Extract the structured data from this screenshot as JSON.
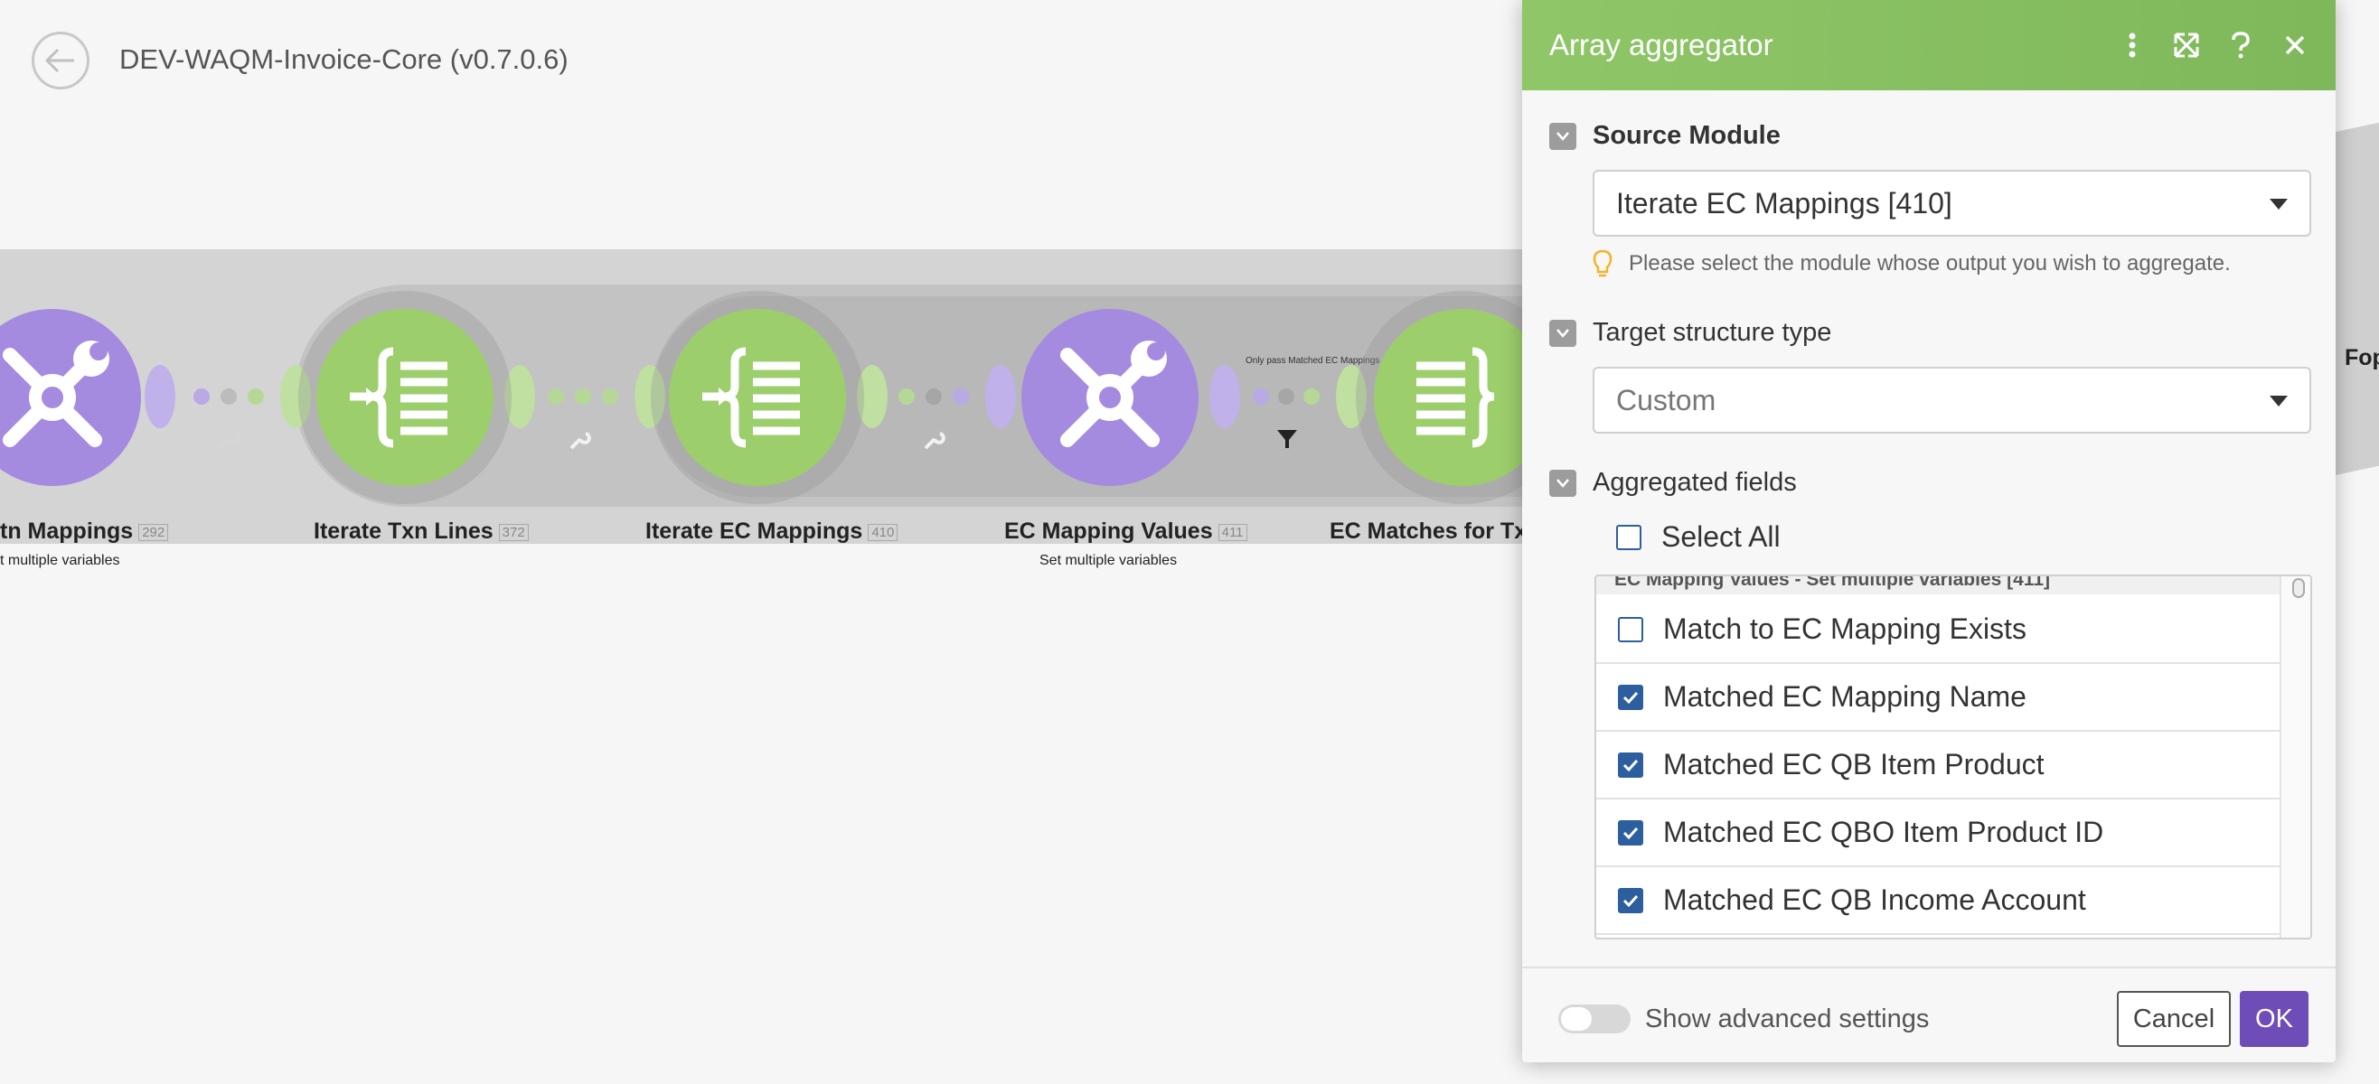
{
  "scenario": {
    "title": "DEV-WAQM-Invoice-Core (v0.7.0.6)"
  },
  "nodes": [
    {
      "label": "tn Mappings",
      "id": "292",
      "sub": "t multiple variables",
      "color": "purple",
      "icon": "tools-icon"
    },
    {
      "label": "Iterate Txn Lines",
      "id": "372",
      "sub": "",
      "color": "green",
      "icon": "iterator-icon"
    },
    {
      "label": "Iterate EC Mappings",
      "id": "410",
      "sub": "",
      "color": "green",
      "icon": "iterator-icon"
    },
    {
      "label": "EC Mapping Values",
      "id": "411",
      "sub": "Set multiple variables",
      "color": "purple",
      "icon": "tools-icon"
    },
    {
      "label": "EC Matches for Tx",
      "id": "",
      "sub": "",
      "color": "green",
      "icon": "aggregator-icon"
    }
  ],
  "filter": {
    "label": "Only pass Matched EC Mappings"
  },
  "right_node": {
    "label": "Fop"
  },
  "panel": {
    "title": "Array aggregator",
    "source_module": {
      "label": "Source Module",
      "value": "Iterate EC Mappings [410]",
      "hint": "Please select the module whose output you wish to aggregate."
    },
    "target_structure": {
      "label": "Target structure type",
      "value": "Custom"
    },
    "aggregated_fields": {
      "label": "Aggregated fields",
      "select_all": "Select All",
      "group": "EC Mapping Values - Set multiple variables [411]",
      "items": [
        {
          "label": "Match to EC Mapping Exists",
          "checked": false
        },
        {
          "label": "Matched EC Mapping Name",
          "checked": true
        },
        {
          "label": "Matched EC QB Item Product",
          "checked": true
        },
        {
          "label": "Matched EC QBO Item Product ID",
          "checked": true
        },
        {
          "label": "Matched EC QB Income Account",
          "checked": true
        }
      ]
    },
    "footer": {
      "advanced": "Show advanced settings",
      "cancel": "Cancel",
      "ok": "OK"
    }
  },
  "colors": {
    "purple": "#a58be0",
    "green": "#9dce6c",
    "header": "#8fc668",
    "accent": "#6e4db9",
    "checkbox": "#2d5f9e"
  }
}
